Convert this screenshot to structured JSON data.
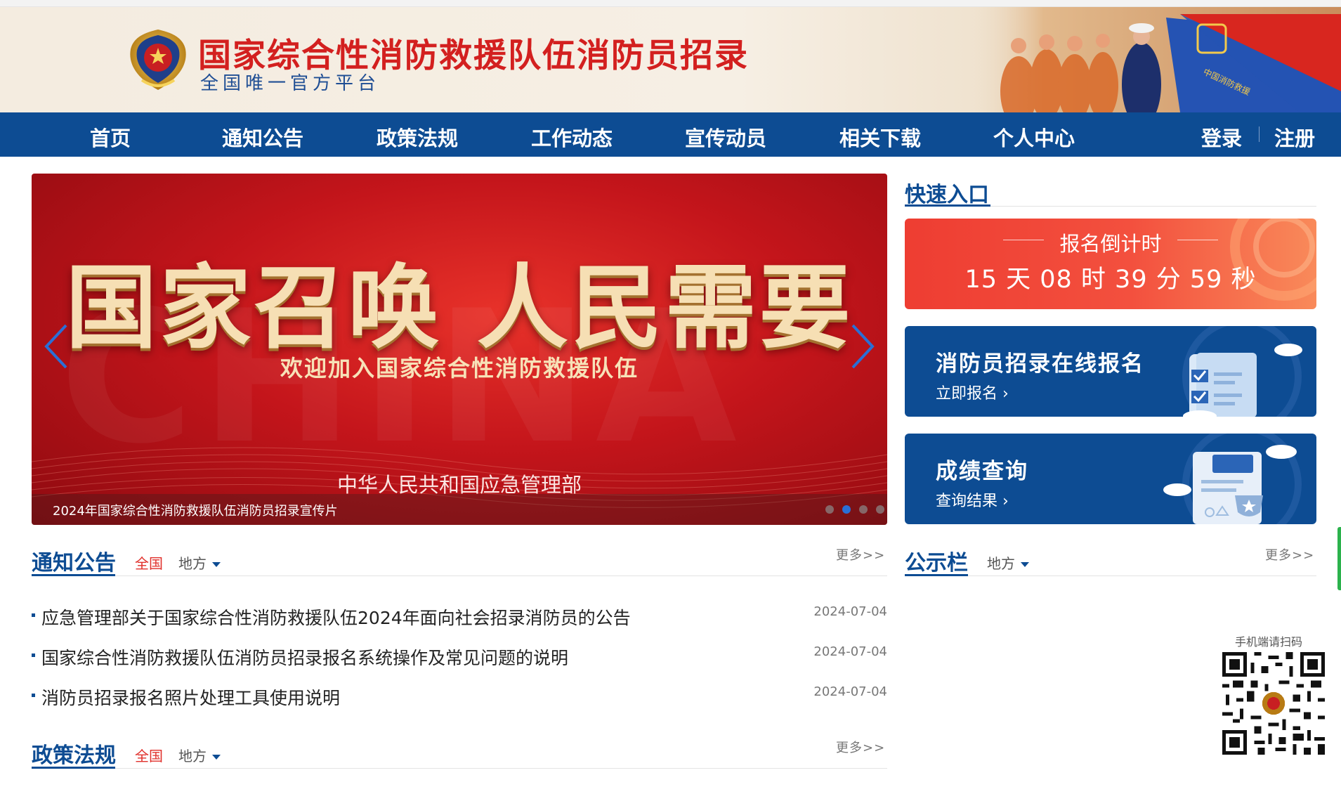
{
  "header": {
    "title": "国家综合性消防救援队伍消防员招录",
    "subtitle": "全国唯一官方平台"
  },
  "nav": {
    "items": [
      {
        "label": "首页"
      },
      {
        "label": "通知公告"
      },
      {
        "label": "政策法规"
      },
      {
        "label": "工作动态"
      },
      {
        "label": "宣传动员"
      },
      {
        "label": "相关下载"
      },
      {
        "label": "个人中心"
      }
    ],
    "login": "登录",
    "register": "注册"
  },
  "carousel": {
    "headline": "国家召唤 人民需要",
    "tagline": "欢迎加入国家综合性消防救援队伍",
    "organization": "中华人民共和国应急管理部",
    "caption": "2024年国家综合性消防救援队伍消防员招录宣传片",
    "slide_count": 4,
    "active_slide": 2
  },
  "quick_entry": {
    "title": "快速入口",
    "countdown": {
      "label": "报名倒计时",
      "text": "15 天 08 时 39 分 59 秒"
    },
    "cards": [
      {
        "title": "消防员招录在线报名",
        "link": "立即报名"
      },
      {
        "title": "成绩查询",
        "link": "查询结果"
      }
    ]
  },
  "notices": {
    "title": "通知公告",
    "tab_national": "全国",
    "tab_local": "地方",
    "more": "更多>>",
    "items": [
      {
        "text": "应急管理部关于国家综合性消防救援队伍2024年面向社会招录消防员的公告",
        "date": "2024-07-04"
      },
      {
        "text": "国家综合性消防救援队伍消防员招录报名系统操作及常见问题的说明",
        "date": "2024-07-04"
      },
      {
        "text": "消防员招录报名照片处理工具使用说明",
        "date": "2024-07-04"
      }
    ]
  },
  "bulletin": {
    "title": "公示栏",
    "tab_local": "地方",
    "more": "更多>>"
  },
  "policies": {
    "title": "政策法规",
    "tab_national": "全国",
    "tab_local": "地方",
    "more": "更多>>"
  },
  "qr": {
    "label": "手机端请扫码"
  },
  "colors": {
    "brand_blue": "#0d4c93",
    "title_red": "#d3201f",
    "countdown_red": "#ee3d32",
    "tab_active_red": "#e0302b"
  }
}
